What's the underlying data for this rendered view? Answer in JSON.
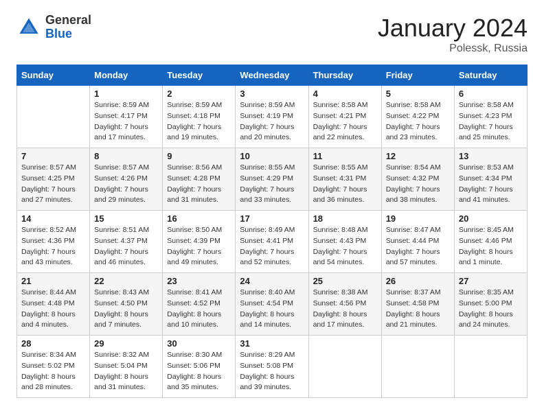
{
  "logo": {
    "general": "General",
    "blue": "Blue"
  },
  "title": {
    "month": "January 2024",
    "location": "Polessk, Russia"
  },
  "weekdays": [
    "Sunday",
    "Monday",
    "Tuesday",
    "Wednesday",
    "Thursday",
    "Friday",
    "Saturday"
  ],
  "weeks": [
    [
      {
        "day": "",
        "sunrise": "",
        "sunset": "",
        "daylight": ""
      },
      {
        "day": "1",
        "sunrise": "Sunrise: 8:59 AM",
        "sunset": "Sunset: 4:17 PM",
        "daylight": "Daylight: 7 hours and 17 minutes."
      },
      {
        "day": "2",
        "sunrise": "Sunrise: 8:59 AM",
        "sunset": "Sunset: 4:18 PM",
        "daylight": "Daylight: 7 hours and 19 minutes."
      },
      {
        "day": "3",
        "sunrise": "Sunrise: 8:59 AM",
        "sunset": "Sunset: 4:19 PM",
        "daylight": "Daylight: 7 hours and 20 minutes."
      },
      {
        "day": "4",
        "sunrise": "Sunrise: 8:58 AM",
        "sunset": "Sunset: 4:21 PM",
        "daylight": "Daylight: 7 hours and 22 minutes."
      },
      {
        "day": "5",
        "sunrise": "Sunrise: 8:58 AM",
        "sunset": "Sunset: 4:22 PM",
        "daylight": "Daylight: 7 hours and 23 minutes."
      },
      {
        "day": "6",
        "sunrise": "Sunrise: 8:58 AM",
        "sunset": "Sunset: 4:23 PM",
        "daylight": "Daylight: 7 hours and 25 minutes."
      }
    ],
    [
      {
        "day": "7",
        "sunrise": "Sunrise: 8:57 AM",
        "sunset": "Sunset: 4:25 PM",
        "daylight": "Daylight: 7 hours and 27 minutes."
      },
      {
        "day": "8",
        "sunrise": "Sunrise: 8:57 AM",
        "sunset": "Sunset: 4:26 PM",
        "daylight": "Daylight: 7 hours and 29 minutes."
      },
      {
        "day": "9",
        "sunrise": "Sunrise: 8:56 AM",
        "sunset": "Sunset: 4:28 PM",
        "daylight": "Daylight: 7 hours and 31 minutes."
      },
      {
        "day": "10",
        "sunrise": "Sunrise: 8:55 AM",
        "sunset": "Sunset: 4:29 PM",
        "daylight": "Daylight: 7 hours and 33 minutes."
      },
      {
        "day": "11",
        "sunrise": "Sunrise: 8:55 AM",
        "sunset": "Sunset: 4:31 PM",
        "daylight": "Daylight: 7 hours and 36 minutes."
      },
      {
        "day": "12",
        "sunrise": "Sunrise: 8:54 AM",
        "sunset": "Sunset: 4:32 PM",
        "daylight": "Daylight: 7 hours and 38 minutes."
      },
      {
        "day": "13",
        "sunrise": "Sunrise: 8:53 AM",
        "sunset": "Sunset: 4:34 PM",
        "daylight": "Daylight: 7 hours and 41 minutes."
      }
    ],
    [
      {
        "day": "14",
        "sunrise": "Sunrise: 8:52 AM",
        "sunset": "Sunset: 4:36 PM",
        "daylight": "Daylight: 7 hours and 43 minutes."
      },
      {
        "day": "15",
        "sunrise": "Sunrise: 8:51 AM",
        "sunset": "Sunset: 4:37 PM",
        "daylight": "Daylight: 7 hours and 46 minutes."
      },
      {
        "day": "16",
        "sunrise": "Sunrise: 8:50 AM",
        "sunset": "Sunset: 4:39 PM",
        "daylight": "Daylight: 7 hours and 49 minutes."
      },
      {
        "day": "17",
        "sunrise": "Sunrise: 8:49 AM",
        "sunset": "Sunset: 4:41 PM",
        "daylight": "Daylight: 7 hours and 52 minutes."
      },
      {
        "day": "18",
        "sunrise": "Sunrise: 8:48 AM",
        "sunset": "Sunset: 4:43 PM",
        "daylight": "Daylight: 7 hours and 54 minutes."
      },
      {
        "day": "19",
        "sunrise": "Sunrise: 8:47 AM",
        "sunset": "Sunset: 4:44 PM",
        "daylight": "Daylight: 7 hours and 57 minutes."
      },
      {
        "day": "20",
        "sunrise": "Sunrise: 8:45 AM",
        "sunset": "Sunset: 4:46 PM",
        "daylight": "Daylight: 8 hours and 1 minute."
      }
    ],
    [
      {
        "day": "21",
        "sunrise": "Sunrise: 8:44 AM",
        "sunset": "Sunset: 4:48 PM",
        "daylight": "Daylight: 8 hours and 4 minutes."
      },
      {
        "day": "22",
        "sunrise": "Sunrise: 8:43 AM",
        "sunset": "Sunset: 4:50 PM",
        "daylight": "Daylight: 8 hours and 7 minutes."
      },
      {
        "day": "23",
        "sunrise": "Sunrise: 8:41 AM",
        "sunset": "Sunset: 4:52 PM",
        "daylight": "Daylight: 8 hours and 10 minutes."
      },
      {
        "day": "24",
        "sunrise": "Sunrise: 8:40 AM",
        "sunset": "Sunset: 4:54 PM",
        "daylight": "Daylight: 8 hours and 14 minutes."
      },
      {
        "day": "25",
        "sunrise": "Sunrise: 8:38 AM",
        "sunset": "Sunset: 4:56 PM",
        "daylight": "Daylight: 8 hours and 17 minutes."
      },
      {
        "day": "26",
        "sunrise": "Sunrise: 8:37 AM",
        "sunset": "Sunset: 4:58 PM",
        "daylight": "Daylight: 8 hours and 21 minutes."
      },
      {
        "day": "27",
        "sunrise": "Sunrise: 8:35 AM",
        "sunset": "Sunset: 5:00 PM",
        "daylight": "Daylight: 8 hours and 24 minutes."
      }
    ],
    [
      {
        "day": "28",
        "sunrise": "Sunrise: 8:34 AM",
        "sunset": "Sunset: 5:02 PM",
        "daylight": "Daylight: 8 hours and 28 minutes."
      },
      {
        "day": "29",
        "sunrise": "Sunrise: 8:32 AM",
        "sunset": "Sunset: 5:04 PM",
        "daylight": "Daylight: 8 hours and 31 minutes."
      },
      {
        "day": "30",
        "sunrise": "Sunrise: 8:30 AM",
        "sunset": "Sunset: 5:06 PM",
        "daylight": "Daylight: 8 hours and 35 minutes."
      },
      {
        "day": "31",
        "sunrise": "Sunrise: 8:29 AM",
        "sunset": "Sunset: 5:08 PM",
        "daylight": "Daylight: 8 hours and 39 minutes."
      },
      {
        "day": "",
        "sunrise": "",
        "sunset": "",
        "daylight": ""
      },
      {
        "day": "",
        "sunrise": "",
        "sunset": "",
        "daylight": ""
      },
      {
        "day": "",
        "sunrise": "",
        "sunset": "",
        "daylight": ""
      }
    ]
  ]
}
